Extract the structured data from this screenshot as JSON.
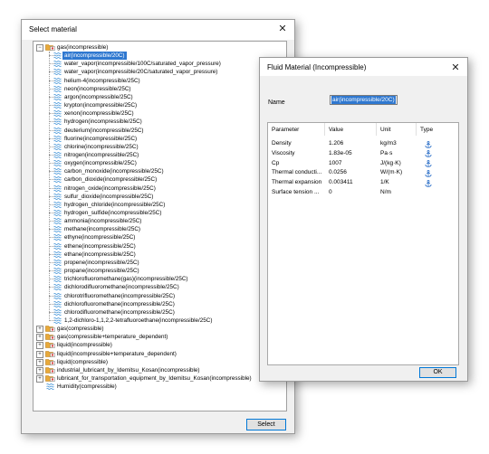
{
  "select_window": {
    "title": "Select material",
    "close_glyph": "✕",
    "select_label": "Select",
    "tree": {
      "root": {
        "label": "gas(incompressible)",
        "expanded": true
      },
      "children": [
        "air(incompressible/20C)",
        "water_vapor(incompressible/100C/saturated_vapor_pressure)",
        "water_vapor(incompressible/20C/saturated_vapor_pressure)",
        "helium-4(incompressible/25C)",
        "neon(incompressible/25C)",
        "argon(incompressible/25C)",
        "krypton(incompressible/25C)",
        "xenon(incompressible/25C)",
        "hydrogen(incompressible/25C)",
        "deuterium(incompressible/25C)",
        "fluorine(incompressible/25C)",
        "chlorine(incompressible/25C)",
        "nitrogen(incompressible/25C)",
        "oxygen(incompressible/25C)",
        "carbon_monoxide(incompressible/25C)",
        "carbon_dioxide(incompressible/25C)",
        "nitrogen_oxide(incompressible/25C)",
        "sulfur_dioxide(incompressible/25C)",
        "hydrogen_chloride(incompressible/25C)",
        "hydrogen_sulfide(incompressible/25C)",
        "ammonia(incompressible/25C)",
        "methane(incompressible/25C)",
        "ethyne(incompressible/25C)",
        "ethene(incompressible/25C)",
        "ethane(incompressible/25C)",
        "propene(incompressible/25C)",
        "propane(incompressible/25C)",
        "trichlorofluoromethane(gas)(incompressible/25C)",
        "dichlorodifluoromethane(incompressible/25C)",
        "chlorotrifluoromethane(incompressible/25C)",
        "dichlorofluoromethane(incompressible/25C)",
        "chlorodifluoromethane(incompressible/25C)",
        "1,2-dichloro-1,1,2,2-tetrafluoroethane(incompressible/25C)"
      ],
      "selected_index": 0,
      "other_groups": [
        "gas(compressible)",
        "gas(compressible+temperature_dependent)",
        "liquid(incompressible)",
        "liquid(incompressible+temperature_dependent)",
        "liquid(compressible)",
        "industrial_lubricant_by_Idemitsu_Kosan(incompressible)",
        "lubricant_for_transportation_equipment_by_Idemitsu_Kosan(incompressible)"
      ],
      "humidity_item": "Humidity(compressible)"
    }
  },
  "fluid_window": {
    "title": "Fluid Material (Incompressible)",
    "close_glyph": "✕",
    "name_label": "Name",
    "name_value": "air(incompressible/20C)",
    "columns": [
      "Parameter",
      "Value",
      "Unit",
      "Type"
    ],
    "rows": [
      {
        "parameter": "Density",
        "value": "1.206",
        "unit": "kg/m3",
        "type_icon": "anchor-icon"
      },
      {
        "parameter": "Viscosity",
        "value": "1.83e-05",
        "unit": "Pa·s",
        "type_icon": "anchor-icon"
      },
      {
        "parameter": "Cp",
        "value": "1007",
        "unit": "J/(kg·K)",
        "type_icon": "anchor-icon"
      },
      {
        "parameter": "Thermal conducti...",
        "value": "0.0256",
        "unit": "W/(m·K)",
        "type_icon": "anchor-icon"
      },
      {
        "parameter": "Thermal expansion",
        "value": "0.003411",
        "unit": "1/K",
        "type_icon": "anchor-icon"
      },
      {
        "parameter": "Surface tension ...",
        "value": "0",
        "unit": "N/m",
        "type_icon": ""
      }
    ],
    "ok_label": "OK"
  },
  "colors": {
    "selection": "#2f78d0",
    "folder": "#e8a93a",
    "material_icon": "#3a8fd6",
    "anchor": "#2b6fc8"
  }
}
